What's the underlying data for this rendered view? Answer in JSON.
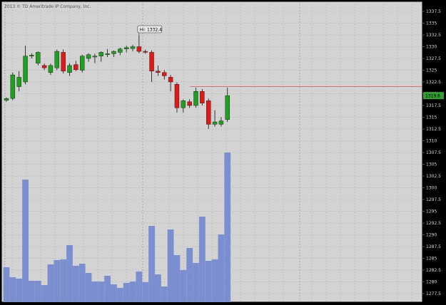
{
  "copyright": "2013 © TD Ameritrade IP Company, Inc.",
  "hi_label": "Hi: 1332.4",
  "last_price_label": "1319.6",
  "colors": {
    "background": "#d3d3d3",
    "frame": "#000000",
    "grid": "#8c8c8c",
    "up_candle": "#20a020",
    "down_candle": "#e01818",
    "volume": "#7b8fd0",
    "reference_line": "#e05050",
    "last_price_bg": "#2ea02e"
  },
  "chart_data": {
    "type": "candlestick",
    "y_axis": {
      "min": 1277.5,
      "max": 1337.5,
      "tick_labels": [
        "1337.5",
        "1335",
        "1332.5",
        "1330",
        "1327.5",
        "1325",
        "1322.5",
        "1320",
        "1317.5",
        "1315",
        "1312.5",
        "1310",
        "1307.5",
        "1305",
        "1302.5",
        "1300",
        "1297.5",
        "1295",
        "1292.5",
        "1290",
        "1287.5",
        "1285",
        "1282.5",
        "1280",
        "1277.5"
      ]
    },
    "price_range": [
      1277.5,
      1337.5
    ],
    "reference_price": 1321.5,
    "hi_value": 1332.4,
    "last_price": 1319.6,
    "grid": true,
    "candles": [
      {
        "o": 1318.6,
        "h": 1319.2,
        "l": 1318.3,
        "c": 1319.0
      },
      {
        "o": 1319.0,
        "h": 1324.5,
        "l": 1318.6,
        "c": 1324.0
      },
      {
        "o": 1321.5,
        "h": 1324.8,
        "l": 1320.5,
        "c": 1323.5
      },
      {
        "o": 1322.5,
        "h": 1330.2,
        "l": 1322.0,
        "c": 1328.0
      },
      {
        "o": 1328.0,
        "h": 1328.6,
        "l": 1327.5,
        "c": 1328.2
      },
      {
        "o": 1326.5,
        "h": 1329.0,
        "l": 1326.0,
        "c": 1328.8
      },
      {
        "o": 1326.0,
        "h": 1326.4,
        "l": 1325.0,
        "c": 1325.5
      },
      {
        "o": 1324.5,
        "h": 1326.4,
        "l": 1324.0,
        "c": 1326.0
      },
      {
        "o": 1325.5,
        "h": 1329.4,
        "l": 1325.0,
        "c": 1329.0
      },
      {
        "o": 1328.8,
        "h": 1329.4,
        "l": 1324.3,
        "c": 1324.8
      },
      {
        "o": 1324.5,
        "h": 1326.5,
        "l": 1323.8,
        "c": 1326.0
      },
      {
        "o": 1326.2,
        "h": 1327.0,
        "l": 1324.8,
        "c": 1325.1
      },
      {
        "o": 1325.0,
        "h": 1328.3,
        "l": 1324.5,
        "c": 1328.0
      },
      {
        "o": 1327.5,
        "h": 1328.6,
        "l": 1326.8,
        "c": 1328.3
      },
      {
        "o": 1327.8,
        "h": 1328.5,
        "l": 1326.5,
        "c": 1328.0
      },
      {
        "o": 1328.0,
        "h": 1329.0,
        "l": 1326.8,
        "c": 1328.8
      },
      {
        "o": 1328.3,
        "h": 1329.5,
        "l": 1327.8,
        "c": 1328.5
      },
      {
        "o": 1328.5,
        "h": 1329.2,
        "l": 1327.8,
        "c": 1329.0
      },
      {
        "o": 1328.8,
        "h": 1329.8,
        "l": 1328.2,
        "c": 1329.5
      },
      {
        "o": 1329.5,
        "h": 1330.2,
        "l": 1328.8,
        "c": 1329.8
      },
      {
        "o": 1329.6,
        "h": 1330.4,
        "l": 1329.0,
        "c": 1330.0
      },
      {
        "o": 1330.0,
        "h": 1332.4,
        "l": 1328.6,
        "c": 1329.0
      },
      {
        "o": 1329.0,
        "h": 1329.4,
        "l": 1328.5,
        "c": 1328.8
      },
      {
        "o": 1328.8,
        "h": 1329.2,
        "l": 1322.5,
        "c": 1324.8
      },
      {
        "o": 1324.8,
        "h": 1326.0,
        "l": 1323.8,
        "c": 1324.5
      },
      {
        "o": 1324.5,
        "h": 1325.0,
        "l": 1323.0,
        "c": 1323.8
      },
      {
        "o": 1323.5,
        "h": 1324.0,
        "l": 1320.5,
        "c": 1322.5
      },
      {
        "o": 1322.0,
        "h": 1322.4,
        "l": 1316.0,
        "c": 1317.0
      },
      {
        "o": 1317.0,
        "h": 1318.8,
        "l": 1316.0,
        "c": 1318.5
      },
      {
        "o": 1318.3,
        "h": 1318.8,
        "l": 1317.0,
        "c": 1317.5
      },
      {
        "o": 1317.5,
        "h": 1321.3,
        "l": 1317.0,
        "c": 1320.5
      },
      {
        "o": 1320.5,
        "h": 1321.0,
        "l": 1317.5,
        "c": 1318.0
      },
      {
        "o": 1318.5,
        "h": 1319.0,
        "l": 1312.5,
        "c": 1313.5
      },
      {
        "o": 1313.5,
        "h": 1316.5,
        "l": 1313.0,
        "c": 1314.0
      },
      {
        "o": 1313.5,
        "h": 1315.0,
        "l": 1313.0,
        "c": 1314.2
      },
      {
        "o": 1314.5,
        "h": 1321.3,
        "l": 1314.0,
        "c": 1319.6
      }
    ],
    "volume": [
      49,
      35,
      33,
      172,
      30,
      30,
      24,
      53,
      59,
      60,
      80,
      51,
      54,
      41,
      29,
      29,
      37,
      25,
      20,
      27,
      29,
      43,
      28,
      107,
      39,
      22,
      102,
      66,
      45,
      76,
      55,
      120,
      58,
      60,
      95,
      210
    ]
  }
}
